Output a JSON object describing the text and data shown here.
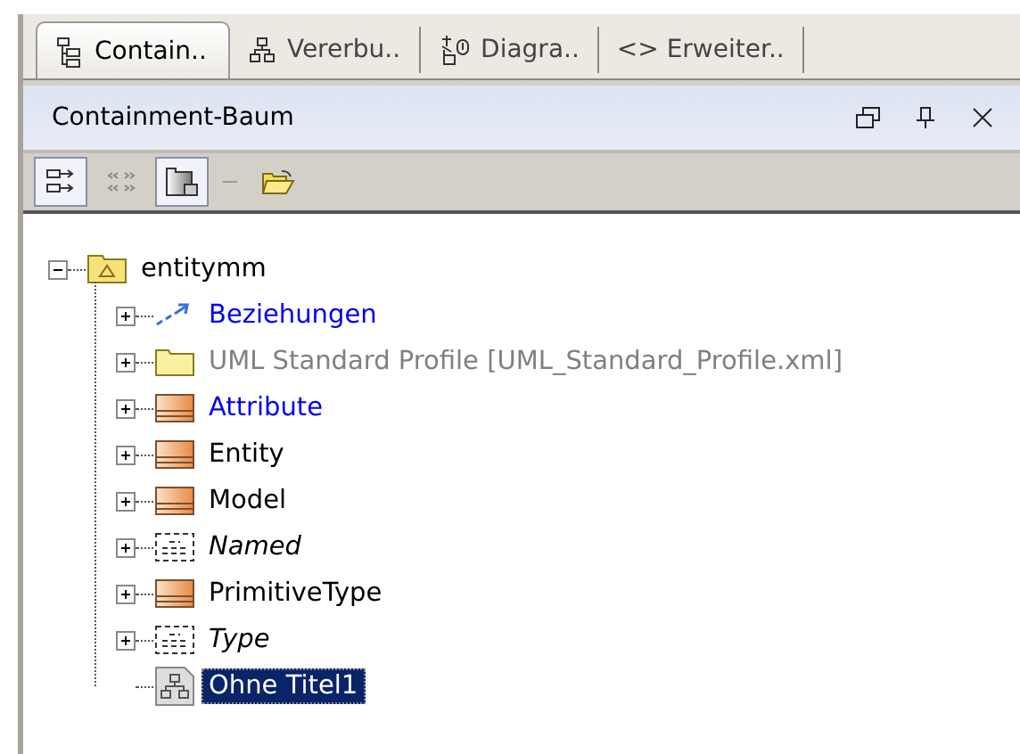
{
  "tabs": [
    {
      "label": "Contain..",
      "kind": "tree",
      "selected": true
    },
    {
      "label": "Vererbu..",
      "kind": "hierarchy",
      "selected": false
    },
    {
      "label": "Diagra..",
      "kind": "diagram",
      "selected": false
    },
    {
      "label": "<> Erweiter..",
      "kind": "text",
      "selected": false
    }
  ],
  "panel": {
    "title": "Containment-Baum"
  },
  "toolbar": [
    {
      "kind": "expand",
      "pressed": true
    },
    {
      "kind": "angles",
      "pressed": false
    },
    {
      "kind": "box",
      "pressed": true
    },
    {
      "kind": "separator"
    },
    {
      "kind": "folder-open",
      "pressed": false
    }
  ],
  "tree": {
    "label": "entitymm",
    "kind": "package",
    "expanded": true,
    "selected": false,
    "children": [
      {
        "label": "Beziehungen",
        "kind": "relations",
        "color": "#0000ee",
        "italic": false,
        "expanded": false,
        "selected": false
      },
      {
        "label": "UML Standard Profile [UML_Standard_Profile.xml]",
        "kind": "folder",
        "color": "#808080",
        "italic": false,
        "expanded": false,
        "selected": false
      },
      {
        "label": "Attribute",
        "kind": "class",
        "color": "#0000ee",
        "italic": false,
        "expanded": false,
        "selected": false
      },
      {
        "label": "Entity",
        "kind": "class",
        "color": "#000000",
        "italic": false,
        "expanded": false,
        "selected": false
      },
      {
        "label": "Model",
        "kind": "class",
        "color": "#000000",
        "italic": false,
        "expanded": false,
        "selected": false
      },
      {
        "label": "Named",
        "kind": "abstract",
        "color": "#000000",
        "italic": true,
        "expanded": false,
        "selected": false
      },
      {
        "label": "PrimitiveType",
        "kind": "class",
        "color": "#000000",
        "italic": false,
        "expanded": false,
        "selected": false
      },
      {
        "label": "Type",
        "kind": "abstract",
        "color": "#000000",
        "italic": true,
        "expanded": false,
        "selected": false
      },
      {
        "label": "Ohne Titel1",
        "kind": "diagram",
        "selected": true
      }
    ]
  }
}
